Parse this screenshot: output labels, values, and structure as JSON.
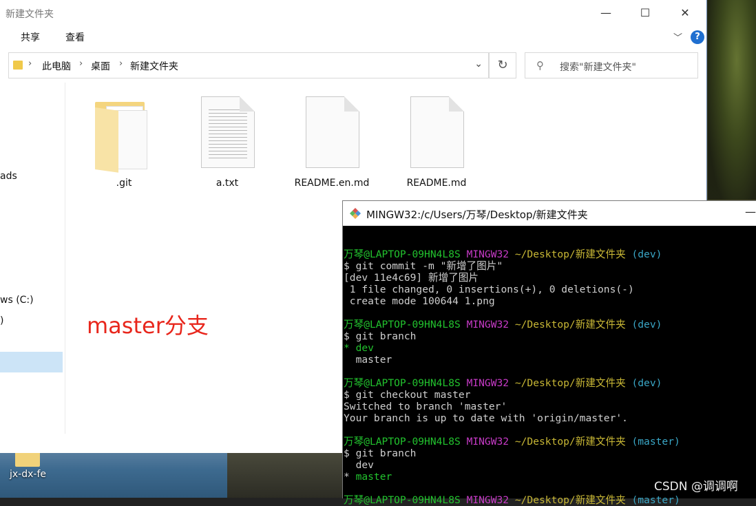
{
  "explorer": {
    "title": "新建文件夹",
    "menu": [
      "共享",
      "查看"
    ],
    "breadcrumb": [
      "此电脑",
      "桌面",
      "新建文件夹"
    ],
    "search_placeholder": "搜索\"新建文件夹\"",
    "nav_items": [
      "ads",
      "ws (C:)",
      ")"
    ],
    "files": [
      {
        "name": ".git",
        "type": "folder"
      },
      {
        "name": "a.txt",
        "type": "text"
      },
      {
        "name": "README.en.md",
        "type": "doc"
      },
      {
        "name": "README.md",
        "type": "doc"
      }
    ],
    "help_label": "?",
    "annotation": "master分支"
  },
  "desktop": {
    "icon_label": "jx-dx-fe"
  },
  "terminal": {
    "title": "MINGW32:/c/Users/万琴/Desktop/新建文件夹",
    "lines": [
      [],
      [
        {
          "t": "万琴@LAPTOP-09HN4L8S ",
          "c": "green"
        },
        {
          "t": "MINGW32 ",
          "c": "mag"
        },
        {
          "t": "~/Desktop/新建文件夹 ",
          "c": "yel"
        },
        {
          "t": "(dev)",
          "c": "cyan"
        }
      ],
      [
        {
          "t": "$ git commit -m \"新增了图片\"",
          "c": "white"
        }
      ],
      [
        {
          "t": "[dev 11e4c69] 新增了图片",
          "c": "white"
        }
      ],
      [
        {
          "t": " 1 file changed, 0 insertions(+), 0 deletions(-)",
          "c": "white"
        }
      ],
      [
        {
          "t": " create mode 100644 1.png",
          "c": "white"
        }
      ],
      [],
      [
        {
          "t": "万琴@LAPTOP-09HN4L8S ",
          "c": "green"
        },
        {
          "t": "MINGW32 ",
          "c": "mag"
        },
        {
          "t": "~/Desktop/新建文件夹 ",
          "c": "yel"
        },
        {
          "t": "(dev)",
          "c": "cyan"
        }
      ],
      [
        {
          "t": "$ git branch",
          "c": "white"
        }
      ],
      [
        {
          "t": "* dev",
          "c": "green"
        }
      ],
      [
        {
          "t": "  master",
          "c": "white"
        }
      ],
      [],
      [
        {
          "t": "万琴@LAPTOP-09HN4L8S ",
          "c": "green"
        },
        {
          "t": "MINGW32 ",
          "c": "mag"
        },
        {
          "t": "~/Desktop/新建文件夹 ",
          "c": "yel"
        },
        {
          "t": "(dev)",
          "c": "cyan"
        }
      ],
      [
        {
          "t": "$ git checkout master",
          "c": "white"
        }
      ],
      [
        {
          "t": "Switched to branch 'master'",
          "c": "white"
        }
      ],
      [
        {
          "t": "Your branch is up to date with 'origin/master'.",
          "c": "white"
        }
      ],
      [],
      [
        {
          "t": "万琴@LAPTOP-09HN4L8S ",
          "c": "green"
        },
        {
          "t": "MINGW32 ",
          "c": "mag"
        },
        {
          "t": "~/Desktop/新建文件夹 ",
          "c": "yel"
        },
        {
          "t": "(master)",
          "c": "cyan"
        }
      ],
      [
        {
          "t": "$ git branch",
          "c": "white"
        }
      ],
      [
        {
          "t": "  dev",
          "c": "white"
        }
      ],
      [
        {
          "t": "* ",
          "c": "white"
        },
        {
          "t": "master",
          "c": "green"
        }
      ],
      [],
      [
        {
          "t": "万琴@LAPTOP-09HN4L8S ",
          "c": "green"
        },
        {
          "t": "MINGW32 ",
          "c": "mag"
        },
        {
          "t": "~/Desktop/新建文件夹 ",
          "c": "yel"
        },
        {
          "t": "(master)",
          "c": "cyan"
        }
      ]
    ]
  },
  "watermark": "CSDN @调调啊",
  "colors": {
    "prompt_user": "#22c32e",
    "prompt_host": "#c83bc8",
    "prompt_path": "#c8b735",
    "prompt_branch": "#3aa7c7",
    "annotation": "#e8261c"
  }
}
